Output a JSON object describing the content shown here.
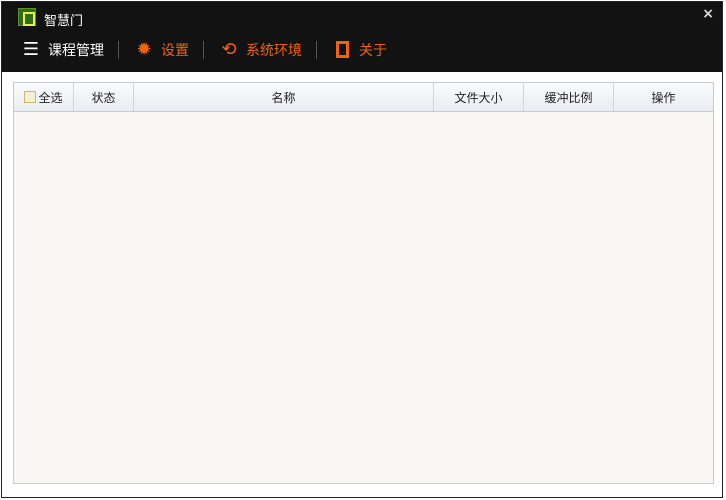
{
  "window": {
    "title": "智慧门",
    "close": "×"
  },
  "menu": [
    {
      "label": "课程管理",
      "icon": "list-icon"
    },
    {
      "label": "设置",
      "icon": "gear-icon"
    },
    {
      "label": "系统环境",
      "icon": "refresh-icon"
    },
    {
      "label": "关于",
      "icon": "square-icon"
    }
  ],
  "table": {
    "select_all": "全选",
    "columns": [
      "状态",
      "名称",
      "文件大小",
      "缓冲比例",
      "操作"
    ]
  },
  "colors": {
    "accent": "#f0640a",
    "topbar": "#121212"
  }
}
